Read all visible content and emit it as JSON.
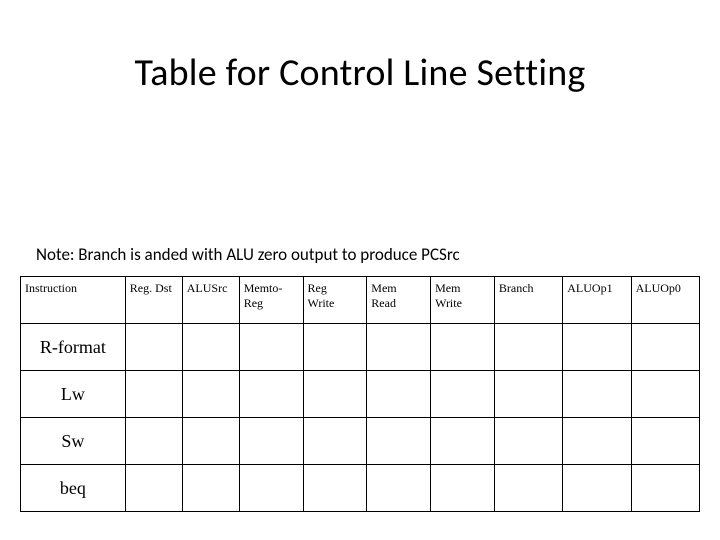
{
  "title": "Table for Control Line Setting",
  "note": "Note: Branch is anded with ALU zero output to produce PCSrc",
  "table": {
    "headers": [
      "Instruction",
      "Reg. Dst",
      "ALUSrc",
      "Memto-\nReg",
      "Reg\nWrite",
      "Mem\nRead",
      "Mem\nWrite",
      "Branch",
      "ALUOp1",
      "ALUOp0"
    ],
    "rows": [
      {
        "label": "R-format",
        "cells": [
          "",
          "",
          "",
          "",
          "",
          "",
          "",
          "",
          ""
        ]
      },
      {
        "label": "Lw",
        "cells": [
          "",
          "",
          "",
          "",
          "",
          "",
          "",
          "",
          ""
        ]
      },
      {
        "label": "Sw",
        "cells": [
          "",
          "",
          "",
          "",
          "",
          "",
          "",
          "",
          ""
        ]
      },
      {
        "label": "beq",
        "cells": [
          "",
          "",
          "",
          "",
          "",
          "",
          "",
          "",
          ""
        ]
      }
    ]
  }
}
